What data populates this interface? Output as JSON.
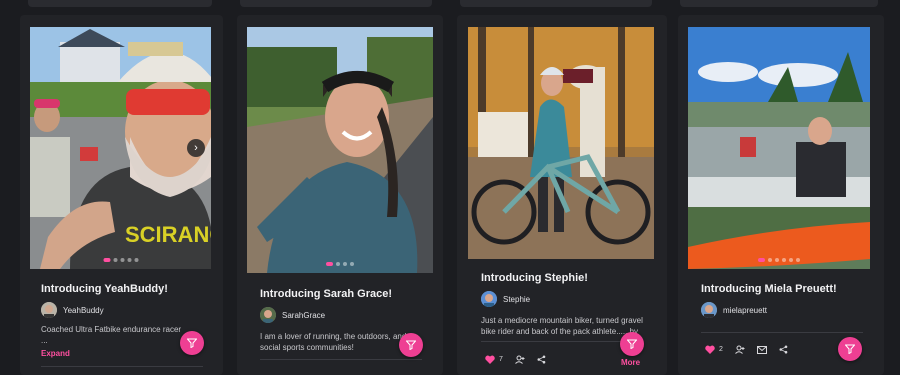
{
  "colors": {
    "background": "#1b1c20",
    "card": "#222327",
    "accent": "#ee3f93",
    "text": "#f2f2f4"
  },
  "cards": [
    {
      "title": "Introducing YeahBuddy!",
      "author": "YeahBuddy",
      "bio_lines": [
        "Coached Ultra Fatbike endurance racer",
        "..."
      ],
      "expand_label": "Expand",
      "fab_icon": "filter-icon",
      "has_next_arrow": true
    },
    {
      "title": "Introducing Sarah Grace!",
      "author": "SarahGrace",
      "bio_lines": [
        "I am a lover of running, the outdoors, and",
        "social sports communities!"
      ],
      "fab_icon": "filter-icon"
    },
    {
      "title": "Introducing Stephie!",
      "author": "Stephie",
      "bio_lines": [
        "Just a mediocre mountain biker, turned gravel",
        "bike rider and back of the pack athlete..... by"
      ],
      "more_label": "More",
      "likes": "7",
      "fab_icon": "filter-icon"
    },
    {
      "title": "Introducing Miela Preuett!",
      "author": "mielapreuett",
      "likes": "2",
      "fab_icon": "filter-icon"
    }
  ]
}
